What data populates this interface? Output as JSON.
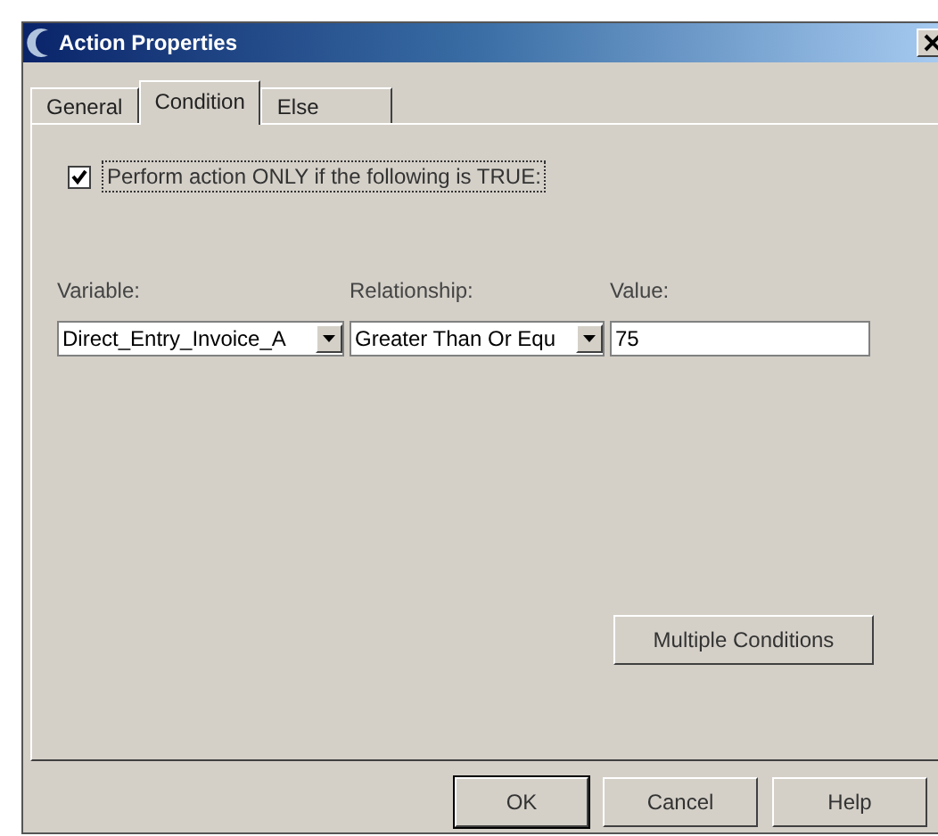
{
  "window": {
    "title": "Action Properties"
  },
  "tabs": [
    {
      "label": "General",
      "selected": false
    },
    {
      "label": "Condition",
      "selected": true
    },
    {
      "label": "Else",
      "selected": false
    }
  ],
  "condition": {
    "checkbox": {
      "label": "Perform action ONLY if the following is TRUE:",
      "checked": true
    },
    "fields": [
      {
        "kind": "combo",
        "label": "Variable:",
        "value": "Direct_Entry_Invoice_A"
      },
      {
        "kind": "combo",
        "label": "Relationship:",
        "value": "Greater Than Or Equ"
      },
      {
        "kind": "text",
        "label": "Value:",
        "value": "75"
      }
    ],
    "multiple_button": "Multiple Conditions"
  },
  "buttons": [
    {
      "label": "OK",
      "default": true
    },
    {
      "label": "Cancel",
      "default": false
    },
    {
      "label": "Help",
      "default": false
    }
  ]
}
